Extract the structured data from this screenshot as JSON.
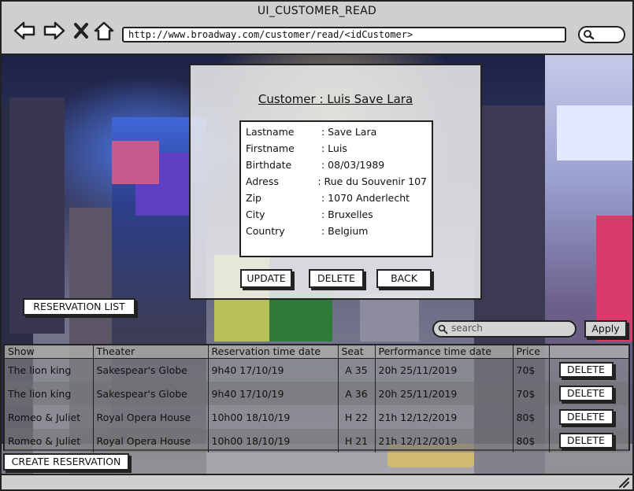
{
  "window": {
    "title": "UI_CUSTOMER_READ"
  },
  "browser": {
    "url": "http://www.broadway.com/customer/read/<idCustomer>",
    "icons": [
      "back-arrow-icon",
      "forward-arrow-icon",
      "close-icon",
      "home-icon",
      "search-icon"
    ]
  },
  "customer": {
    "title": "Customer : Luis Save Lara",
    "fields": [
      {
        "label": "Lastname",
        "value": ": Save Lara"
      },
      {
        "label": "Firstname",
        "value": ": Luis"
      },
      {
        "label": "Birthdate",
        "value": ": 08/03/1989"
      },
      {
        "label": "Adress",
        "value": ": Rue du Souvenir 107"
      },
      {
        "label": "Zip",
        "value": ": 1070 Anderlecht"
      },
      {
        "label": "City",
        "value": ": Bruxelles"
      },
      {
        "label": "Country",
        "value": ": Belgium"
      }
    ],
    "actions": {
      "update": "UPDATE",
      "delete": "DELETE",
      "back": "BACK"
    }
  },
  "reservations": {
    "list_label": "RESERVATION LIST",
    "search_placeholder": "search",
    "apply_label": "Apply",
    "columns": [
      "Show",
      "Theater",
      "Reservation time date",
      "Seat",
      "Performance time date",
      "Price",
      ""
    ],
    "rows": [
      {
        "show": "The lion king",
        "theater": "Sakespear's Globe",
        "reservation": "9h40 17/10/19",
        "seat": "A 35",
        "performance": "20h 25/11/2019",
        "price": "70$",
        "action": "DELETE"
      },
      {
        "show": "The lion king",
        "theater": "Sakespear's Globe",
        "reservation": "9h40 17/10/19",
        "seat": "A 36",
        "performance": "20h 25/11/2019",
        "price": "70$",
        "action": "DELETE"
      },
      {
        "show": "Romeo & Juliet",
        "theater": "Royal Opera House",
        "reservation": "10h00 18/10/19",
        "seat": "H 22",
        "performance": "21h 12/12/2019",
        "price": "80$",
        "action": "DELETE"
      },
      {
        "show": "Romeo & Juliet",
        "theater": "Royal Opera House",
        "reservation": "10h00 18/10/19",
        "seat": "H 21",
        "performance": "21h 12/12/2019",
        "price": "80$",
        "action": "DELETE"
      }
    ],
    "create_label": "CREATE RESERVATION"
  }
}
